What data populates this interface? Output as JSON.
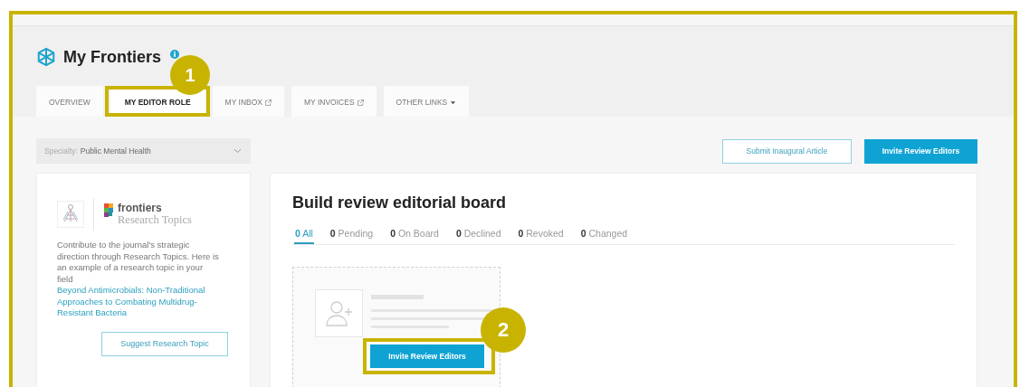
{
  "header": {
    "title": "My Frontiers"
  },
  "tabs": [
    {
      "label": "OVERVIEW",
      "selected": false,
      "kind": "plain"
    },
    {
      "label": "MY EDITOR ROLE",
      "selected": true,
      "kind": "plain"
    },
    {
      "label": "MY INBOX",
      "selected": false,
      "kind": "external"
    },
    {
      "label": "MY INVOICES",
      "selected": false,
      "kind": "external"
    },
    {
      "label": "OTHER LINKS",
      "selected": false,
      "kind": "menu"
    }
  ],
  "specialty": {
    "label": "Specialty:",
    "value": "Public Mental Health"
  },
  "actions": [
    {
      "label": "Submit Inaugural Article",
      "kind": "outline"
    },
    {
      "label": "Invite Review Editors",
      "kind": "primary"
    }
  ],
  "promo": {
    "logo_name": "frontiers",
    "logo_subtitle": "Research Topics",
    "text": "Contribute to the journal's strategic direction through Research Topics. Here is an example of a research topic in your field ",
    "link": "Beyond Antimicrobials: Non-Traditional Approaches to Combating Multidrug-Resistant Bacteria",
    "button": "Suggest Research Topic"
  },
  "board": {
    "title": "Build review editorial board",
    "filters": [
      {
        "count": "0",
        "label": "All",
        "selected": true
      },
      {
        "count": "0",
        "label": "Pending",
        "selected": false
      },
      {
        "count": "0",
        "label": "On Board",
        "selected": false
      },
      {
        "count": "0",
        "label": "Declined",
        "selected": false
      },
      {
        "count": "0",
        "label": "Revoked",
        "selected": false
      },
      {
        "count": "0",
        "label": "Changed",
        "selected": false
      }
    ],
    "empty_button": "Invite Review Editors"
  },
  "annotations": [
    {
      "label": "1"
    },
    {
      "label": "2"
    }
  ]
}
